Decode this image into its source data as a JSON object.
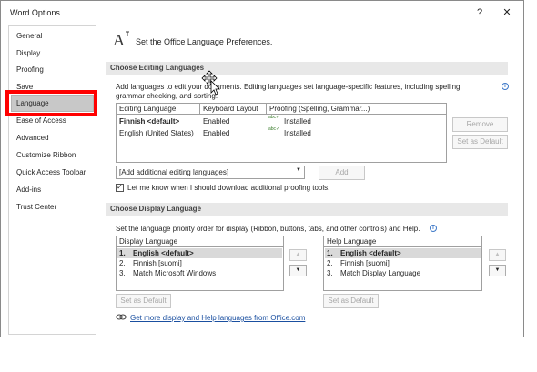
{
  "window": {
    "title": "Word Options",
    "help_label": "?",
    "close_label": "✕"
  },
  "sidebar": {
    "items": [
      {
        "label": "General"
      },
      {
        "label": "Display"
      },
      {
        "label": "Proofing"
      },
      {
        "label": "Save"
      },
      {
        "label": "Language"
      },
      {
        "label": "Ease of Access"
      },
      {
        "label": "Advanced"
      },
      {
        "label": "Customize Ribbon"
      },
      {
        "label": "Quick Access Toolbar"
      },
      {
        "label": "Add-ins"
      },
      {
        "label": "Trust Center"
      }
    ],
    "selected": "Language"
  },
  "header": {
    "icon_glyph": "A",
    "title": "Set the Office Language Preferences."
  },
  "editing": {
    "section_title": "Choose Editing Languages",
    "description_line1": "Add languages to edit your documents. Editing languages set language-specific features, including spelling,",
    "description_line2": "grammar checking, and sorting.",
    "columns": [
      "Editing Language",
      "Keyboard Layout",
      "Proofing (Spelling, Grammar...)"
    ],
    "rows": [
      {
        "language": "Finnish <default>",
        "keyboard": "Enabled",
        "proofing_icon": "abc✓",
        "proofing": "Installed"
      },
      {
        "language": "English (United States)",
        "keyboard": "Enabled",
        "proofing_icon": "abc✓",
        "proofing": "Installed"
      }
    ],
    "remove_label": "Remove",
    "set_default_label": "Set as Default",
    "add_dropdown_value": "[Add additional editing languages]",
    "add_label": "Add",
    "checkbox_label": "Let me know when I should download additional proofing tools.",
    "checkbox_checked": true
  },
  "display": {
    "section_title": "Choose Display Language",
    "description": "Set the language priority order for display (Ribbon, buttons, tabs, and other controls) and Help.",
    "display_header": "Display Language",
    "display_items": [
      {
        "num": "1.",
        "label": "English <default>"
      },
      {
        "num": "2.",
        "label": "Finnish [suomi]"
      },
      {
        "num": "3.",
        "label": "Match Microsoft Windows"
      }
    ],
    "help_header": "Help Language",
    "help_items": [
      {
        "num": "1.",
        "label": "English <default>"
      },
      {
        "num": "2.",
        "label": "Finnish [suomi]"
      },
      {
        "num": "3.",
        "label": "Match Display Language"
      }
    ],
    "set_default_label": "Set as Default",
    "up_glyph": "▲",
    "down_glyph": "▼",
    "link_text": "Get more display and Help languages from Office.com"
  },
  "colors": {
    "accent": "#1a4fa0",
    "highlight": "#ff0000",
    "section_bg": "#e8e8e8"
  }
}
